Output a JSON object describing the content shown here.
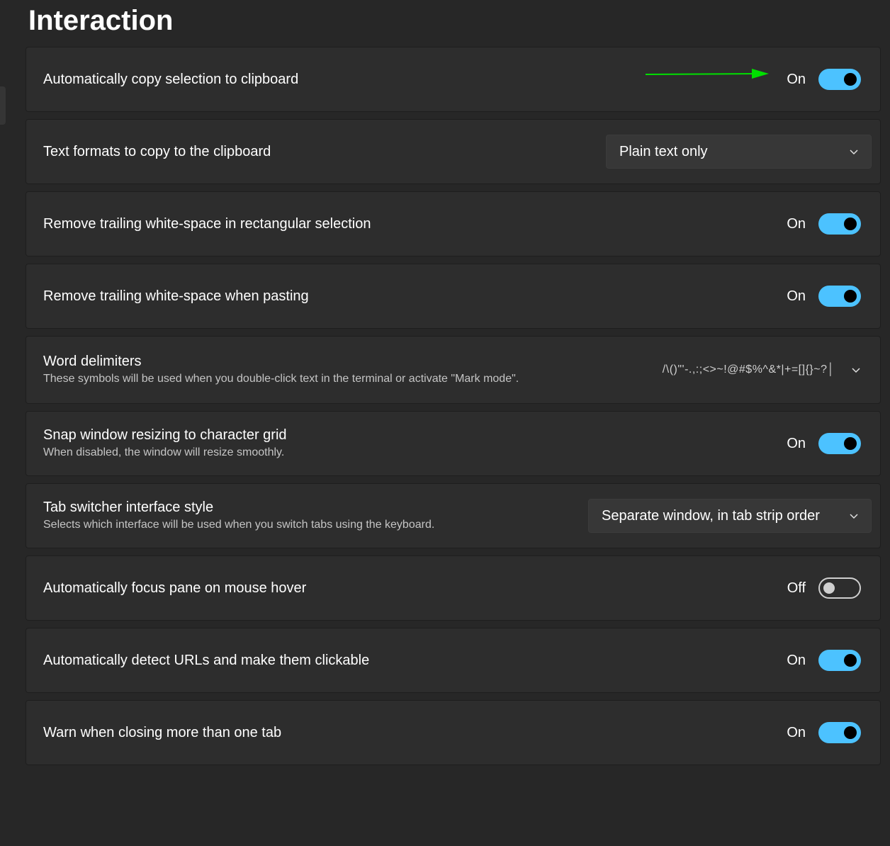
{
  "page": {
    "title": "Interaction"
  },
  "settings": [
    {
      "label": "Automatically copy selection to clipboard",
      "state": "On"
    },
    {
      "label": "Text formats to copy to the clipboard",
      "value": "Plain text only"
    },
    {
      "label": "Remove trailing white-space in rectangular selection",
      "state": "On"
    },
    {
      "label": "Remove trailing white-space when pasting",
      "state": "On"
    },
    {
      "label": "Word delimiters",
      "description": "These symbols will be used when you double-click text in the terminal or activate \"Mark mode\".",
      "value": "/\\()\"'-.,:;<>~!@#$%^&*|+=[]{}~?│"
    },
    {
      "label": "Snap window resizing to character grid",
      "description": "When disabled, the window will resize smoothly.",
      "state": "On"
    },
    {
      "label": "Tab switcher interface style",
      "description": "Selects which interface will be used when you switch tabs using the keyboard.",
      "value": "Separate window, in tab strip order"
    },
    {
      "label": "Automatically focus pane on mouse hover",
      "state": "Off"
    },
    {
      "label": "Automatically detect URLs and make them clickable",
      "state": "On"
    },
    {
      "label": "Warn when closing more than one tab",
      "state": "On"
    }
  ],
  "colors": {
    "background": "#272727",
    "card": "#2d2d2d",
    "accent": "#4cc2ff",
    "annotation_arrow": "#00e000"
  },
  "icons": {
    "dropdown": "chevron-down-icon",
    "annotation": "arrow-right-icon"
  }
}
